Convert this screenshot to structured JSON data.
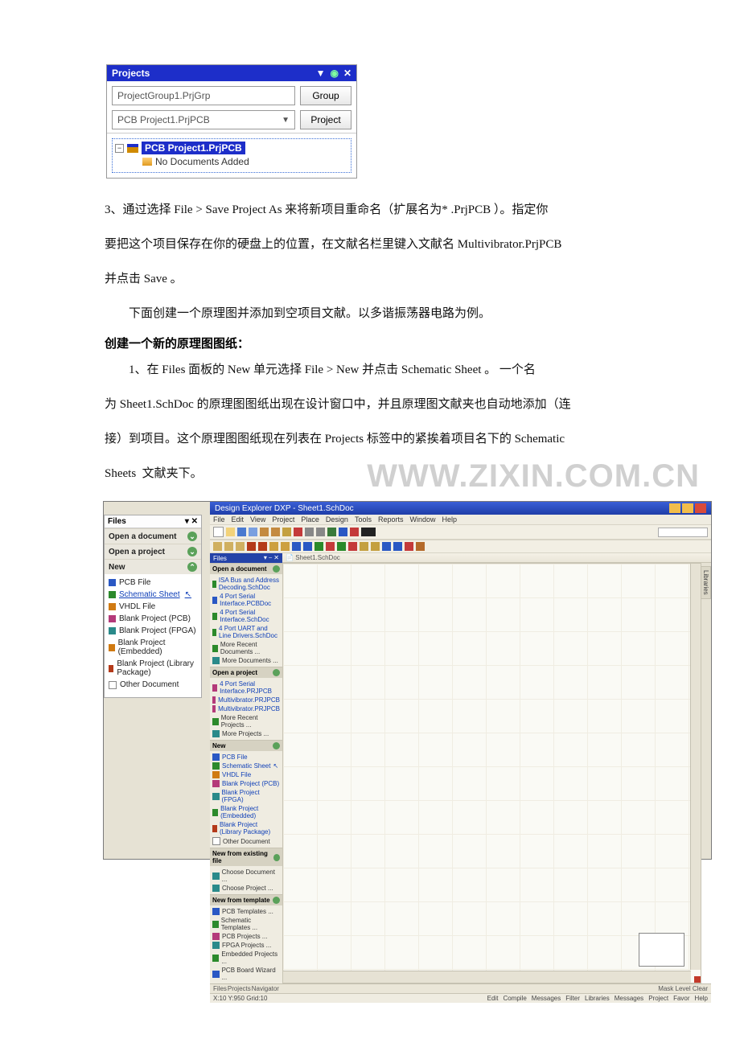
{
  "projects_panel": {
    "title": "Projects",
    "group_input": "ProjectGroup1.PrjGrp",
    "group_btn": "Group",
    "project_input": "PCB Project1.PrjPCB",
    "project_btn": "Project",
    "tree_selected": "PCB Project1.PrjPCB",
    "tree_nodocs": "No Documents Added"
  },
  "body": {
    "p3a": "3、通过选择 File > Save Project As 来将新项目重命名（扩展名为* .PrjPCB ）。指定你",
    "p3b": "要把这个项目保存在你的硬盘上的位置，在文献名栏里键入文献名 Multivibrator.PrjPCB ",
    "p3c": "并点击 Save 。",
    "p4": "下面创建一个原理图并添加到空项目文献。以多谐振荡器电路为例。",
    "heading": "创建一个新的原理图图纸：",
    "p5a": "1、在 Files 面板的 New 单元选择 File > New 并点击 Schematic Sheet 。 一个名",
    "p5b": "为 Sheet1.SchDoc 的原理图图纸出现在设计窗口中，并且原理图文献夹也自动地添加（连",
    "p5c": "接）到项目。这个原理图图纸现在列表在 Projects 标签中的紧挨着项目名下的 Schematic ",
    "p5d": "Sheets  文献夹下。"
  },
  "watermark": "WWW.ZIXIN.COM.CN",
  "files_panel": {
    "title": "Files",
    "open_doc": "Open a document",
    "open_proj": "Open a project",
    "new": "New",
    "new_items": [
      "PCB File",
      "Schematic Sheet",
      "VHDL File",
      "Blank Project (PCB)",
      "Blank Project (FPGA)",
      "Blank Project (Embedded)",
      "Blank Project (Library Package)",
      "Other Document"
    ]
  },
  "dock": {
    "top_title": "Files",
    "s1": "Open a document",
    "s1_items": [
      "ISA Bus and Address Decoding.SchDoc",
      "4 Port Serial Interface.PCBDoc",
      "4 Port Serial Interface.SchDoc",
      "4 Port UART and Line Drivers.SchDoc",
      "More Recent Documents ...",
      "More Documents ..."
    ],
    "s2": "Open a project",
    "s2_items": [
      "4 Port Serial Interface.PRJPCB",
      "Multivibrator.PRJPCB",
      "Multivibrator.PRJPCB",
      "More Recent Projects ...",
      "More Projects ..."
    ],
    "s3": "New",
    "s3_items": [
      "PCB File",
      "Schematic Sheet",
      "VHDL File",
      "Blank Project (PCB)",
      "Blank Project (FPGA)",
      "Blank Project (Embedded)",
      "Blank Project (Library Package)",
      "Other Document"
    ],
    "s4": "New from existing file",
    "s4_items": [
      "Choose Document ...",
      "Choose Project ..."
    ],
    "s5": "New from template",
    "s5_items": [
      "PCB Templates ...",
      "Schematic Templates ...",
      "PCB Projects ...",
      "FPGA Projects ...",
      "Embedded Projects ...",
      "PCB Board Wizard ..."
    ]
  },
  "app": {
    "title": "Design Explorer DXP - Sheet1.SchDoc",
    "menu": [
      "File",
      "Edit",
      "View",
      "Project",
      "Place",
      "Design",
      "Tools",
      "Reports",
      "Window",
      "Help"
    ],
    "folder_tab": "Sheet1.SchDoc",
    "status_left_tabs": [
      "Files",
      "Projects",
      "Navigator"
    ],
    "status_pos": "X:10 Y:950  Grid:10",
    "status_right": [
      "Edit",
      "Compile",
      "Messages",
      "Filter",
      "Libraries",
      "Messages",
      "Project",
      "Favor",
      "Help"
    ],
    "mask_level": "Mask Level   Clear",
    "libraries": "Libraries"
  }
}
